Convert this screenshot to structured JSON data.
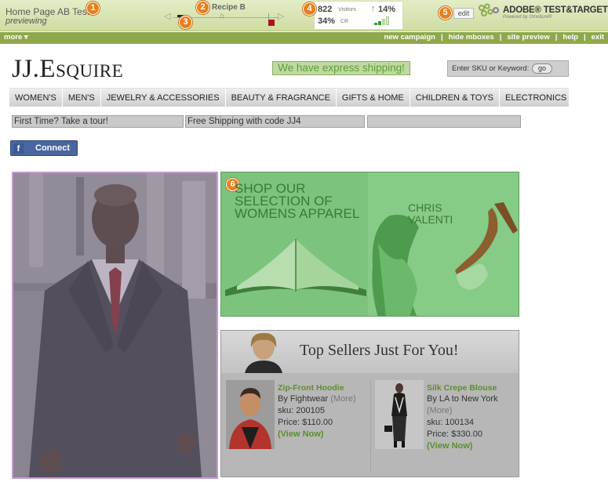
{
  "tt_bar": {
    "test_name": "Home Page AB Test",
    "status": "previewing",
    "recipe": "Recipe B",
    "visitors_value": "822",
    "visitors_label": "Visitors",
    "lift": "14%",
    "cr_value": "34%",
    "cr_label": "CR",
    "edit_label": "edit",
    "brand": "ADOBE® TEST&TARGET",
    "brand_sub": "Powered by Omniture®",
    "badges": [
      "1",
      "2",
      "3",
      "4",
      "5",
      "6"
    ]
  },
  "menu_bar": {
    "more_label": "more ▾",
    "links": [
      "new campaign",
      "hide mboxes",
      "site preview",
      "help",
      "exit"
    ]
  },
  "site": {
    "logo": "JJ.Esquire",
    "express_banner": "We have express shipping!",
    "search_label": "Enter SKU or Keyword:",
    "search_go": "go",
    "categories": [
      "WOMEN'S",
      "MEN'S",
      "JEWELRY & ACCESSORIES",
      "BEAUTY & FRAGRANCE",
      "GIFTS & HOME",
      "CHILDREN & TOYS",
      "ELECTRONICS"
    ],
    "promos": [
      "First Time?  Take a tour!",
      "Free Shipping with code JJ4",
      ""
    ],
    "fb_icon": "f",
    "fb_connect": "Connect",
    "womens_banner": "SHOP OUR SELECTION OF WOMENS APPAREL",
    "chris_valenti": "CHRIS VALENTI",
    "top_sellers_title": "Top Sellers Just For You!",
    "products": [
      {
        "name": "Zip-Front Hoodie",
        "by": "By Fightwear",
        "more": "(More)",
        "sku": "sku: 200105",
        "price": "Price: $110.00",
        "view": "(View Now)"
      },
      {
        "name": "Silk Crepe Blouse",
        "by": "By LA to New York",
        "more": "(More)",
        "sku": "sku: 100134",
        "price": "Price: $330.00",
        "view": "(View Now)"
      }
    ]
  },
  "colors": {
    "tt_bar": "#cfdca3",
    "menu_green": "#8fa84c",
    "badge_orange": "#e8801c",
    "overlay_green": "#7cc47e",
    "link_green": "#5b8f2b"
  }
}
